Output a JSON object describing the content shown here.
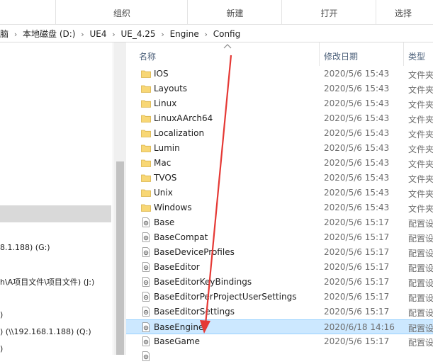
{
  "ribbon": {
    "groups": [
      "组织",
      "新建",
      "打开",
      "选择"
    ]
  },
  "address": {
    "crumbs": [
      "脑",
      "本地磁盘 (D:)",
      "UE4",
      "UE_4.25",
      "Engine",
      "Config"
    ]
  },
  "nav": {
    "items": [
      "8.1.188) (G:)",
      "h\\A项目文件\\项目文件) (J:)",
      ")",
      ") (\\\\192.168.1.188) (Q:)",
      ")"
    ]
  },
  "list": {
    "columns": {
      "name": "名称",
      "date": "修改日期",
      "type": "类型"
    },
    "rows": [
      {
        "name": "IOS",
        "date": "2020/5/6 15:43",
        "type": "文件夹",
        "kind": "folder"
      },
      {
        "name": "Layouts",
        "date": "2020/5/6 15:43",
        "type": "文件夹",
        "kind": "folder"
      },
      {
        "name": "Linux",
        "date": "2020/5/6 15:43",
        "type": "文件夹",
        "kind": "folder"
      },
      {
        "name": "LinuxAArch64",
        "date": "2020/5/6 15:43",
        "type": "文件夹",
        "kind": "folder"
      },
      {
        "name": "Localization",
        "date": "2020/5/6 15:43",
        "type": "文件夹",
        "kind": "folder"
      },
      {
        "name": "Lumin",
        "date": "2020/5/6 15:43",
        "type": "文件夹",
        "kind": "folder"
      },
      {
        "name": "Mac",
        "date": "2020/5/6 15:43",
        "type": "文件夹",
        "kind": "folder"
      },
      {
        "name": "TVOS",
        "date": "2020/5/6 15:43",
        "type": "文件夹",
        "kind": "folder"
      },
      {
        "name": "Unix",
        "date": "2020/5/6 15:43",
        "type": "文件夹",
        "kind": "folder"
      },
      {
        "name": "Windows",
        "date": "2020/5/6 15:43",
        "type": "文件夹",
        "kind": "folder"
      },
      {
        "name": "Base",
        "date": "2020/5/6 15:17",
        "type": "配置设",
        "kind": "config"
      },
      {
        "name": "BaseCompat",
        "date": "2020/5/6 15:17",
        "type": "配置设",
        "kind": "config"
      },
      {
        "name": "BaseDeviceProfiles",
        "date": "2020/5/6 15:17",
        "type": "配置设",
        "kind": "config"
      },
      {
        "name": "BaseEditor",
        "date": "2020/5/6 15:17",
        "type": "配置设",
        "kind": "config"
      },
      {
        "name": "BaseEditorKeyBindings",
        "date": "2020/5/6 15:17",
        "type": "配置设",
        "kind": "config"
      },
      {
        "name": "BaseEditorPerProjectUserSettings",
        "date": "2020/5/6 15:17",
        "type": "配置设",
        "kind": "config"
      },
      {
        "name": "BaseEditorSettings",
        "date": "2020/5/6 15:17",
        "type": "配置设",
        "kind": "config"
      },
      {
        "name": "BaseEngine",
        "date": "2020/6/18 14:16",
        "type": "配置设",
        "kind": "config",
        "selected": true
      },
      {
        "name": "BaseGame",
        "date": "2020/5/6 15:17",
        "type": "配置设",
        "kind": "config"
      },
      {
        "name": "",
        "date": "",
        "type": "",
        "kind": "config"
      }
    ]
  },
  "colors": {
    "folder": "#f8d775",
    "selection": "#cce8ff",
    "arrow": "#e53935"
  },
  "icons": {
    "folder": "folder-icon",
    "config": "config-file-icon",
    "sort": "sort-caret-icon"
  }
}
